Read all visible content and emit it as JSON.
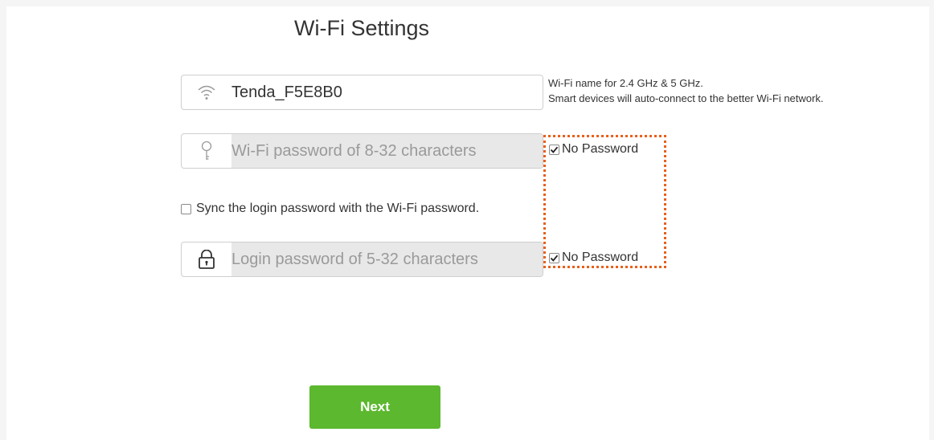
{
  "page": {
    "title": "Wi-Fi Settings",
    "wifi_name": {
      "value": "Tenda_F5E8B0",
      "icon": "wifi-icon",
      "hint_line1": "Wi-Fi name for 2.4 GHz & 5 GHz.",
      "hint_line2": "Smart devices will auto-connect to the better Wi-Fi network."
    },
    "wifi_password": {
      "placeholder": "Wi-Fi password of 8-32 characters",
      "icon": "key-icon",
      "no_password_label": "No Password",
      "no_password_checked": true
    },
    "sync": {
      "label": "Sync the login password with the Wi-Fi password.",
      "checked": false
    },
    "login_password": {
      "placeholder": "Login password of 5-32 characters",
      "icon": "lock-icon",
      "no_password_label": "No Password",
      "no_password_checked": true
    },
    "next_button": {
      "label": "Next"
    }
  },
  "colors": {
    "accent": "#5cb82e",
    "highlight": "#e8601c"
  }
}
